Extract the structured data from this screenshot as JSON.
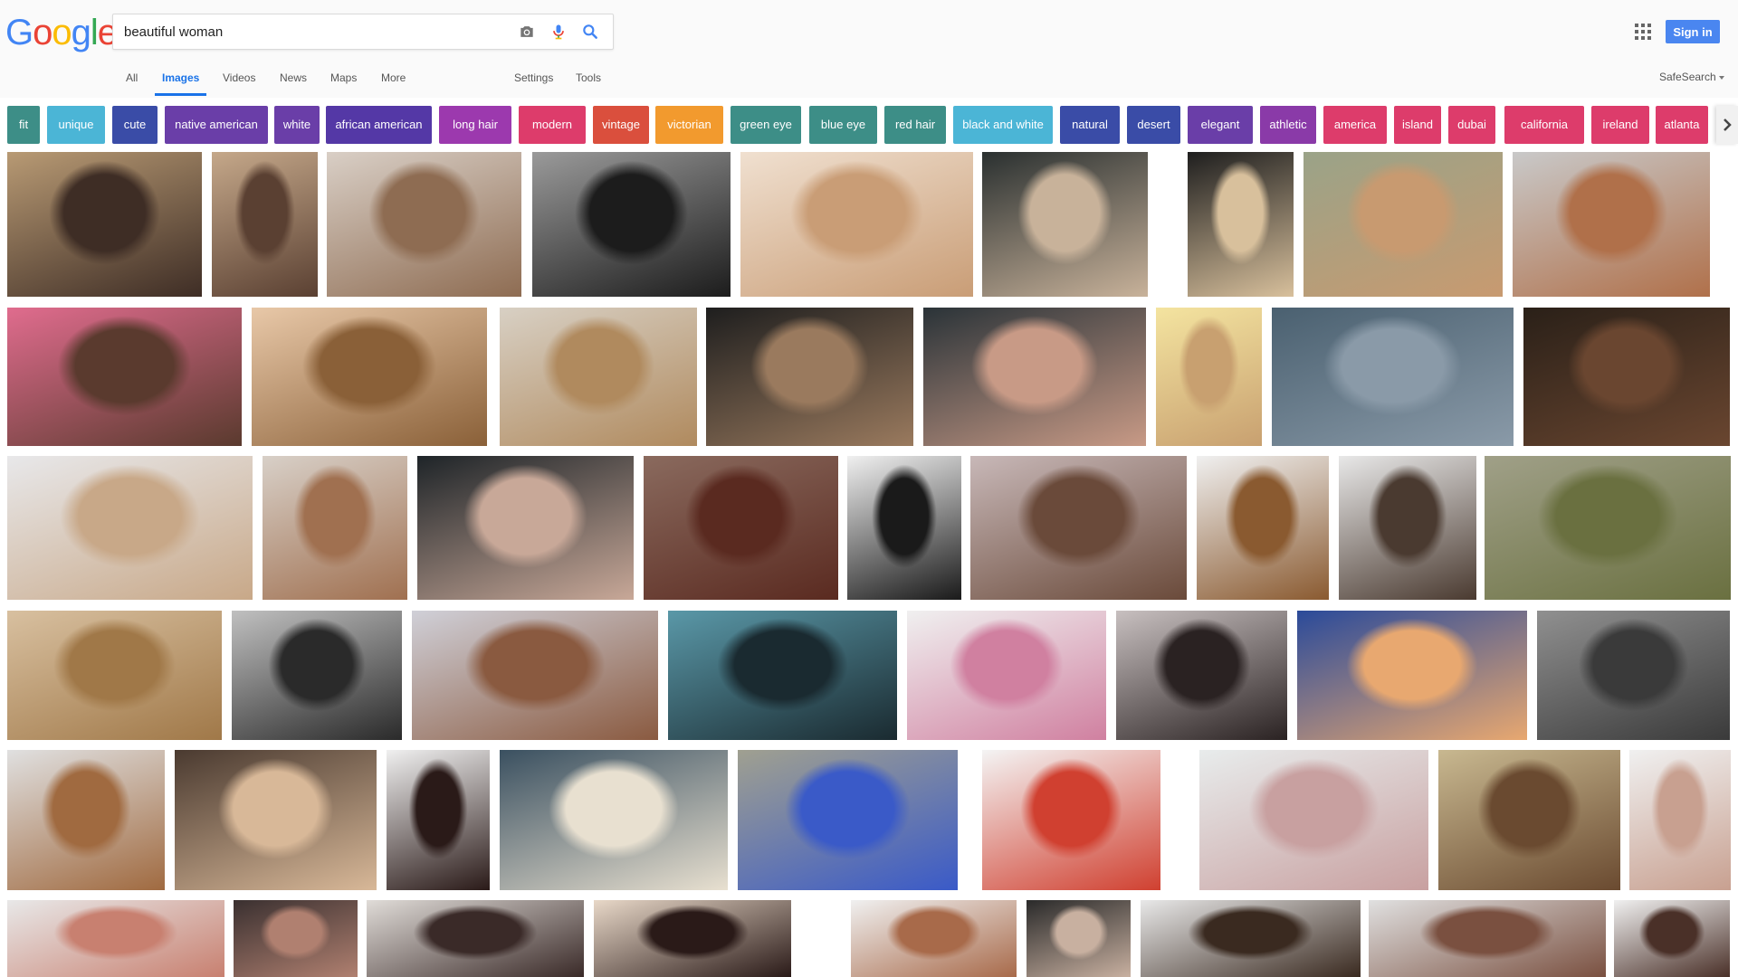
{
  "logo": {
    "letters": [
      {
        "ch": "G",
        "color": "#4285F4"
      },
      {
        "ch": "o",
        "color": "#EA4335"
      },
      {
        "ch": "o",
        "color": "#FBBC05"
      },
      {
        "ch": "g",
        "color": "#4285F4"
      },
      {
        "ch": "l",
        "color": "#34A853"
      },
      {
        "ch": "e",
        "color": "#EA4335"
      }
    ]
  },
  "search": {
    "value": "beautiful woman"
  },
  "header": {
    "signin_label": "Sign in",
    "accent": "#4a86f0"
  },
  "nav": {
    "items": [
      {
        "label": "All",
        "active": false
      },
      {
        "label": "Images",
        "active": true
      },
      {
        "label": "Videos",
        "active": false
      },
      {
        "label": "News",
        "active": false
      },
      {
        "label": "Maps",
        "active": false
      },
      {
        "label": "More",
        "active": false
      },
      {
        "label": "Settings",
        "active": false
      },
      {
        "label": "Tools",
        "active": false
      }
    ],
    "safesearch_label": "SafeSearch"
  },
  "chips": [
    {
      "label": "fit",
      "color": "#3d8e87"
    },
    {
      "label": "unique",
      "color": "#4bb5d6"
    },
    {
      "label": "cute",
      "color": "#3a4ca7"
    },
    {
      "label": "native american",
      "color": "#6a3ea8"
    },
    {
      "label": "white",
      "color": "#6a3ea8"
    },
    {
      "label": "african american",
      "color": "#5438a6"
    },
    {
      "label": "long hair",
      "color": "#9c39ae"
    },
    {
      "label": "modern",
      "color": "#dd3c6b"
    },
    {
      "label": "vintage",
      "color": "#da4f3d"
    },
    {
      "label": "victorian",
      "color": "#f29a2e"
    },
    {
      "label": "green eye",
      "color": "#3d8e87"
    },
    {
      "label": "blue eye",
      "color": "#3d8e87"
    },
    {
      "label": "red hair",
      "color": "#3d8e87"
    },
    {
      "label": "black and white",
      "color": "#4bb5d6"
    },
    {
      "label": "natural",
      "color": "#3a4ca7"
    },
    {
      "label": "desert",
      "color": "#3a4ca7"
    },
    {
      "label": "elegant",
      "color": "#6a3ea8"
    },
    {
      "label": "athletic",
      "color": "#8a3aa8"
    },
    {
      "label": "america",
      "color": "#dd3c6b"
    },
    {
      "label": "island",
      "color": "#dd3c6b"
    },
    {
      "label": "dubai",
      "color": "#dd3c6b"
    },
    {
      "label": "california",
      "color": "#dd3c6b"
    },
    {
      "label": "ireland",
      "color": "#dd3c6b"
    },
    {
      "label": "atlanta",
      "color": "#dd3c6b"
    }
  ],
  "rows": [
    {
      "tiles": [
        {
          "c1": "#b89a74",
          "c2": "#3e2d25"
        },
        {
          "c1": "#c5a88a",
          "c2": "#5a4032"
        },
        {
          "c1": "#d9cfc6",
          "c2": "#8e6c52"
        },
        {
          "c1": "#9a9a9a",
          "c2": "#1c1c1c"
        },
        {
          "c1": "#f0e0d0",
          "c2": "#c99d76"
        },
        {
          "c1": "#2a3030",
          "c2": "#c8b29a"
        },
        {
          "c1": "#1e1e1e",
          "c2": "#d8c09c"
        },
        {
          "c1": "#9aa388",
          "c2": "#c89a70"
        },
        {
          "c1": "#c9c9c9",
          "c2": "#b0704a"
        }
      ]
    },
    {
      "tiles": [
        {
          "c1": "#e06c8e",
          "c2": "#5a3a2e"
        },
        {
          "c1": "#e8c8a8",
          "c2": "#8a6038"
        },
        {
          "c1": "#d8d0c4",
          "c2": "#b08a5e"
        },
        {
          "c1": "#1e1e1e",
          "c2": "#9a7a5e"
        },
        {
          "c1": "#2a3338",
          "c2": "#c89a86"
        },
        {
          "c1": "#f4e4a0",
          "c2": "#c8a070"
        },
        {
          "c1": "#4a6070",
          "c2": "#8a9aa8"
        },
        {
          "c1": "#2a2018",
          "c2": "#6a4630"
        }
      ]
    },
    {
      "tiles": [
        {
          "c1": "#e8e8ea",
          "c2": "#c8a888"
        },
        {
          "c1": "#d8d0c8",
          "c2": "#a07050"
        },
        {
          "c1": "#1e2428",
          "c2": "#c8a898"
        },
        {
          "c1": "#8a6a5e",
          "c2": "#5a2a20"
        },
        {
          "c1": "#f0f0f0",
          "c2": "#1a1a1a"
        },
        {
          "c1": "#c8b8b8",
          "c2": "#6a4a3a"
        },
        {
          "c1": "#f0f0f0",
          "c2": "#8a5a30"
        },
        {
          "c1": "#e8e8e8",
          "c2": "#4a3a30"
        },
        {
          "c1": "#a0a088",
          "c2": "#6a7040"
        }
      ]
    },
    {
      "tiles": [
        {
          "c1": "#d8c0a0",
          "c2": "#a07848"
        },
        {
          "c1": "#c0c0c0",
          "c2": "#2a2a2a"
        },
        {
          "c1": "#d0d0d8",
          "c2": "#8a5a40"
        },
        {
          "c1": "#5a98a8",
          "c2": "#1a2a30"
        },
        {
          "c1": "#f0f0f0",
          "c2": "#d080a0"
        },
        {
          "c1": "#c8c0c0",
          "c2": "#2a2222"
        },
        {
          "c1": "#2a4a9a",
          "c2": "#e8a870"
        },
        {
          "c1": "#909090",
          "c2": "#3a3a3a"
        }
      ]
    },
    {
      "tiles": [
        {
          "c1": "#e0e0e0",
          "c2": "#a06a40"
        },
        {
          "c1": "#4a3a30",
          "c2": "#d8b898"
        },
        {
          "c1": "#f0f0f0",
          "c2": "#2a1a18"
        },
        {
          "c1": "#3a5060",
          "c2": "#e8e0d0"
        },
        {
          "c1": "#a0a090",
          "c2": "#3a5ac8"
        },
        {
          "c1": "#f4f4f4",
          "c2": "#d04030"
        },
        {
          "c1": "#e8ecec",
          "c2": "#c8a0a0"
        },
        {
          "c1": "#c8b890",
          "c2": "#6a4a30"
        },
        {
          "c1": "#f0f0f0",
          "c2": "#c8a090"
        }
      ]
    },
    {
      "tiles": [
        {
          "c1": "#e8e8e8",
          "c2": "#c88070"
        },
        {
          "c1": "#3a3030",
          "c2": "#b08070"
        },
        {
          "c1": "#e0dcd8",
          "c2": "#3a2a28"
        },
        {
          "c1": "#e8d8c8",
          "c2": "#2a1a18"
        },
        {
          "c1": "#f0f0f0",
          "c2": "#a86a4a"
        },
        {
          "c1": "#2a2a2a",
          "c2": "#c8b0a0"
        },
        {
          "c1": "#e8e8e8",
          "c2": "#3a2a20"
        },
        {
          "c1": "#e0e0e0",
          "c2": "#7a5040"
        },
        {
          "c1": "#f0f0f0",
          "c2": "#4a3028"
        }
      ]
    }
  ]
}
